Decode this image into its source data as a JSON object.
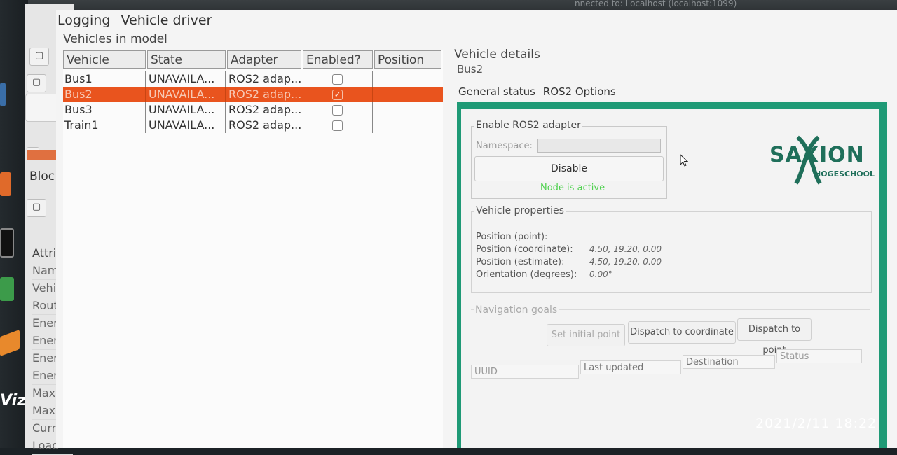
{
  "system_bar": {
    "title": "nnected to: Localhost (localhost:1099)"
  },
  "background_app": {
    "label_bloc": "Bloc",
    "attributes": [
      "Attrit",
      "Name",
      "Vehic",
      "Route",
      "Ener",
      "Ener",
      "Ener",
      "Ener",
      "Maxir",
      "Maxir",
      "Curre",
      "Load"
    ]
  },
  "menu": {
    "items": [
      "Logging",
      "Vehicle driver"
    ]
  },
  "vehicles": {
    "group_title": "Vehicles in model",
    "columns": [
      "Vehicle",
      "State",
      "Adapter",
      "Enabled?",
      "Position"
    ],
    "rows": [
      {
        "vehicle": "Bus1",
        "state": "UNAVAILA...",
        "adapter": "ROS2 adap...",
        "enabled": false,
        "position": ""
      },
      {
        "vehicle": "Bus2",
        "state": "UNAVAILA...",
        "adapter": "ROS2 adap...",
        "enabled": true,
        "position": ""
      },
      {
        "vehicle": "Bus3",
        "state": "UNAVAILA...",
        "adapter": "ROS2 adap...",
        "enabled": false,
        "position": ""
      },
      {
        "vehicle": "Train1",
        "state": "UNAVAILA...",
        "adapter": "ROS2 adap...",
        "enabled": false,
        "position": ""
      }
    ],
    "selected_index": 1
  },
  "details": {
    "group_title": "Vehicle details",
    "vehicle_name": "Bus2",
    "tabs": [
      "General status",
      "ROS2 Options"
    ],
    "ros": {
      "title": "Enable ROS2 adapter",
      "namespace_label": "Namespace:",
      "namespace_value": "",
      "button": "Disable",
      "status": "Node is active"
    },
    "logo": {
      "main": "SAXION",
      "sub": "HOGESCHOOL"
    },
    "properties": {
      "title": "Vehicle properties",
      "rows": [
        {
          "label": "Position (point):",
          "value": ""
        },
        {
          "label": "Position (coordinate):",
          "value": "4.50, 19.20, 0.00"
        },
        {
          "label": "Position (estimate):",
          "value": "4.50, 19.20, 0.00"
        },
        {
          "label": "Orientation (degrees):",
          "value": "0.00°"
        }
      ]
    },
    "navigation": {
      "title": "Navigation goals",
      "buttons": [
        "Set initial point",
        "Dispatch to coordinate",
        "Dispatch to point"
      ],
      "columns": [
        "UUID",
        "Last updated",
        "Destination",
        "Status"
      ]
    }
  },
  "colors": {
    "selection": "#e9541e",
    "frame": "#1f9a76",
    "status_ok": "#4cd04c",
    "logo": "#1f6f5a"
  },
  "timestamp": "2021/2/11  18:22"
}
